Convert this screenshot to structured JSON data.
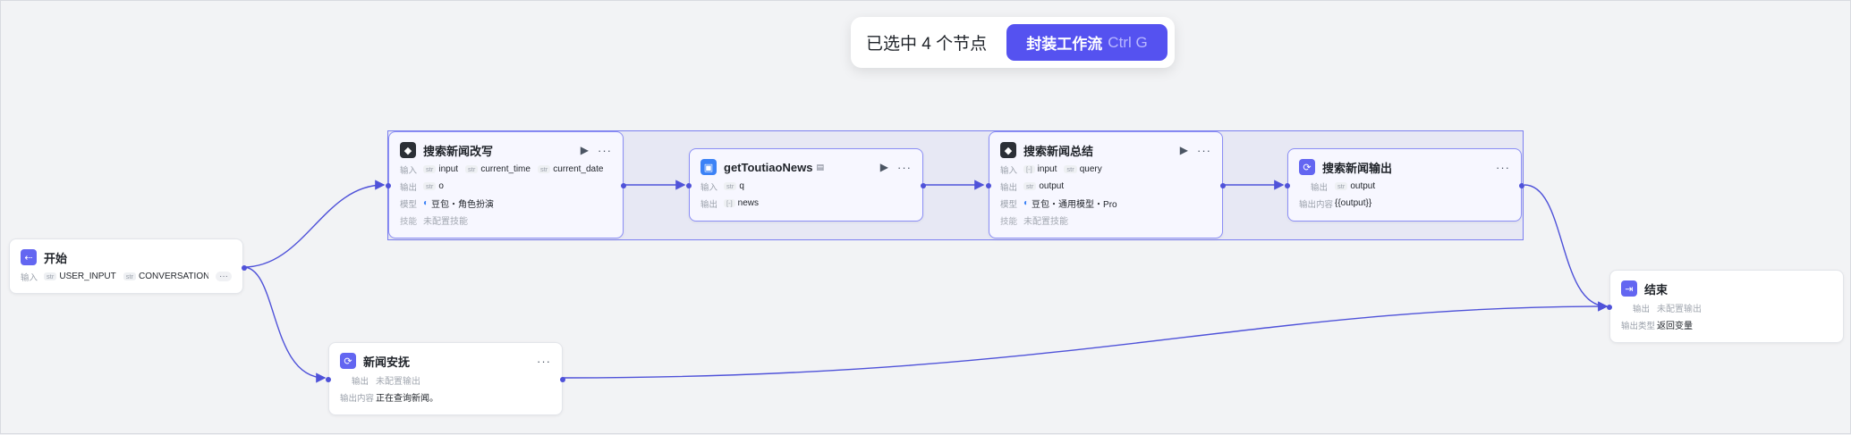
{
  "toast": {
    "label": "已选中 4 个节点",
    "button_label": "封装工作流",
    "button_shortcut": "Ctrl G"
  },
  "nodes": {
    "start": {
      "title": "开始",
      "input_label": "输入",
      "inputs": [
        {
          "type": "str",
          "name": "USER_INPUT"
        },
        {
          "type": "str",
          "name": "CONVERSATION_NAME"
        }
      ],
      "more": "···"
    },
    "rewrite": {
      "title": "搜索新闻改写",
      "input_label": "输入",
      "output_label": "输出",
      "model_label": "模型",
      "skill_label": "技能",
      "inputs": [
        {
          "type": "str",
          "name": "input"
        },
        {
          "type": "str",
          "name": "current_time"
        },
        {
          "type": "str",
          "name": "current_date"
        }
      ],
      "outputs": [
        {
          "type": "str",
          "name": "o"
        }
      ],
      "model": "豆包・角色扮演",
      "skill": "未配置技能"
    },
    "toutiao": {
      "title": "getToutiaoNews",
      "input_label": "输入",
      "output_label": "输出",
      "inputs": [
        {
          "type": "str",
          "name": "q"
        }
      ],
      "outputs": [
        {
          "type": "[-]",
          "name": "news"
        }
      ]
    },
    "summary": {
      "title": "搜索新闻总结",
      "input_label": "输入",
      "output_label": "输出",
      "model_label": "模型",
      "skill_label": "技能",
      "inputs": [
        {
          "type": "[-]",
          "name": "input"
        },
        {
          "type": "str",
          "name": "query"
        }
      ],
      "outputs": [
        {
          "type": "str",
          "name": "output"
        }
      ],
      "model": "豆包・通用模型・Pro",
      "skill": "未配置技能"
    },
    "output": {
      "title": "搜索新闻输出",
      "output_label": "输出",
      "content_label": "输出内容",
      "outputs": [
        {
          "type": "str",
          "name": "output"
        }
      ],
      "content": "{{output}}"
    },
    "comfort": {
      "title": "新闻安抚",
      "output_label": "输出",
      "content_label": "输出内容",
      "output_value": "未配置输出",
      "content": "正在查询新闻。"
    },
    "end": {
      "title": "结束",
      "output_label": "输出",
      "type_label": "输出类型",
      "output_value": "未配置输出",
      "type_value": "返回变量"
    }
  },
  "colors": {
    "accent": "#5552f0",
    "edge": "#4f52d9",
    "selection": "#7b7ff0"
  },
  "icons": {
    "run": "play-icon",
    "more": "more-icon"
  }
}
